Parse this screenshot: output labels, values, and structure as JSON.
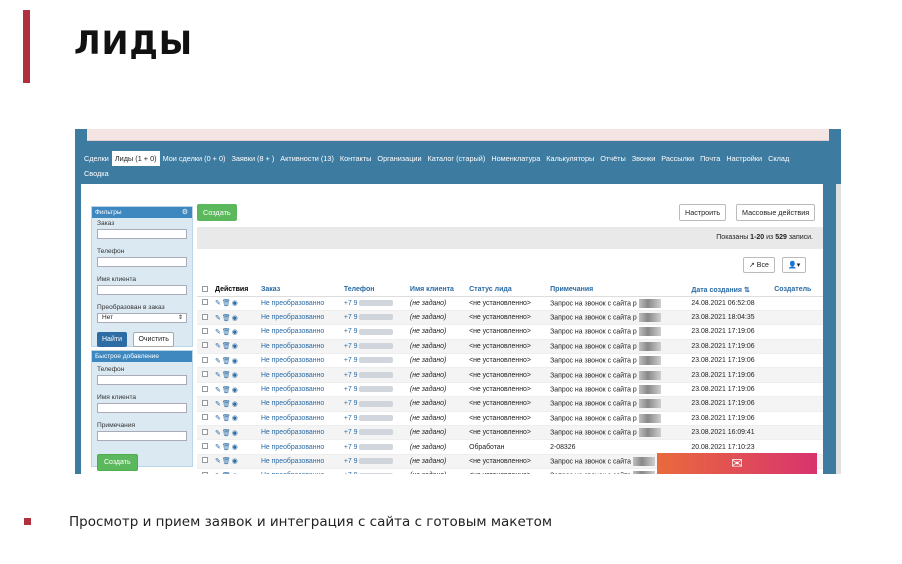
{
  "slide": {
    "title": "ЛИДЫ",
    "caption": "Просмотр и прием заявок и интеграция с сайта с готовым макетом"
  },
  "nav": {
    "tabs": [
      {
        "label": "Сделки",
        "active": false
      },
      {
        "label": "Лиды (1 + 0)",
        "active": true
      },
      {
        "label": "Мои сделки (0 + 0)",
        "active": false
      },
      {
        "label": "Заявки (8 + )",
        "active": false
      },
      {
        "label": "Активности (13)",
        "active": false
      },
      {
        "label": "Контакты",
        "active": false
      },
      {
        "label": "Организации",
        "active": false
      },
      {
        "label": "Каталог (старый)",
        "active": false
      },
      {
        "label": "Номенклатура",
        "active": false
      },
      {
        "label": "Калькуляторы",
        "active": false
      },
      {
        "label": "Отчёты",
        "active": false
      },
      {
        "label": "Звонки",
        "active": false
      },
      {
        "label": "Рассылки",
        "active": false
      },
      {
        "label": "Почта",
        "active": false
      },
      {
        "label": "Настройки",
        "active": false
      },
      {
        "label": "Склад",
        "active": false
      },
      {
        "label": "Сводка",
        "active": false
      }
    ]
  },
  "filters": {
    "title": "Фильтры",
    "order_label": "Заказ",
    "phone_label": "Телефон",
    "client_label": "Имя клиента",
    "converted_label": "Преобразован в заказ",
    "converted_value": "Нет",
    "find_button": "Найти",
    "clear_button": "Очистить"
  },
  "quick_add": {
    "title": "Быстрое добавление",
    "phone_label": "Телефон",
    "client_label": "Имя клиента",
    "note_label": "Примечания",
    "create_button": "Создать"
  },
  "toolbar": {
    "create_button": "Создать",
    "configure_button": "Настроить",
    "bulk_button": "Массовые действия",
    "all_button": "↗ Все",
    "user_button": "▾"
  },
  "shown": {
    "prefix": "Показаны ",
    "range": "1-20",
    "middle": " из ",
    "total": "529",
    "suffix": " записи."
  },
  "table": {
    "columns": [
      "Действия",
      "Заказ",
      "Телефон",
      "Имя клиента",
      "Статус лида",
      "Примечания",
      "Дата создания ⇅",
      "Создатель"
    ],
    "rows": [
      {
        "order": "Не преобразованно",
        "phone": "+7 9",
        "client": "(не задано)",
        "status": "<не установленно>",
        "note": "Запрос на звонок с сайта р",
        "date": "24.08.2021 06:52:08"
      },
      {
        "order": "Не преобразованно",
        "phone": "+7 9",
        "client": "(не задано)",
        "status": "<не установленно>",
        "note": "Запрос на звонок с сайта р",
        "date": "23.08.2021 18:04:35"
      },
      {
        "order": "Не преобразованно",
        "phone": "+7 9",
        "client": "(не задано)",
        "status": "<не установленно>",
        "note": "Запрос на звонок с сайта р",
        "date": "23.08.2021 17:19:06"
      },
      {
        "order": "Не преобразованно",
        "phone": "+7 9",
        "client": "(не задано)",
        "status": "<не установленно>",
        "note": "Запрос на звонок с сайта р",
        "date": "23.08.2021 17:19:06"
      },
      {
        "order": "Не преобразованно",
        "phone": "+7 9",
        "client": "(не задано)",
        "status": "<не установленно>",
        "note": "Запрос на звонок с сайта р",
        "date": "23.08.2021 17:19:06"
      },
      {
        "order": "Не преобразованно",
        "phone": "+7 9",
        "client": "(не задано)",
        "status": "<не установленно>",
        "note": "Запрос на звонок с сайта р",
        "date": "23.08.2021 17:19:06"
      },
      {
        "order": "Не преобразованно",
        "phone": "+7 9",
        "client": "(не задано)",
        "status": "<не установленно>",
        "note": "Запрос на звонок с сайта р",
        "date": "23.08.2021 17:19:06"
      },
      {
        "order": "Не преобразованно",
        "phone": "+7 9",
        "client": "(не задано)",
        "status": "<не установленно>",
        "note": "Запрос на звонок с сайта р",
        "date": "23.08.2021 17:19:06"
      },
      {
        "order": "Не преобразованно",
        "phone": "+7 9",
        "client": "(не задано)",
        "status": "<не установленно>",
        "note": "Запрос на звонок с сайта р",
        "date": "23.08.2021 17:19:06"
      },
      {
        "order": "Не преобразованно",
        "phone": "+7 9",
        "client": "(не задано)",
        "status": "<не установленно>",
        "note": "Запрос на звонок с сайта р",
        "date": "23.08.2021 16:09:41"
      },
      {
        "order": "Не преобразованно",
        "phone": "+7 9",
        "client": "(не задано)",
        "status": "Обработан",
        "note": "2-08326",
        "date": "20.08.2021 17:10:23"
      },
      {
        "order": "Не преобразованно",
        "phone": "+7 9",
        "client": "(не задано)",
        "status": "<не установленно>",
        "note": "Запрос на звонок с сайта",
        "date": ""
      },
      {
        "order": "Не преобразованно",
        "phone": "+7 9",
        "client": "(не задано)",
        "status": "<не установленно>",
        "note": "Запрос на звонок с сайта",
        "date": ""
      }
    ]
  },
  "mail_widget": {
    "icon": "envelope-icon"
  },
  "colors": {
    "accent": "#b1303e",
    "nav_bg": "#3e7ba0",
    "link": "#2a6aa3",
    "green": "#5cb85c"
  }
}
